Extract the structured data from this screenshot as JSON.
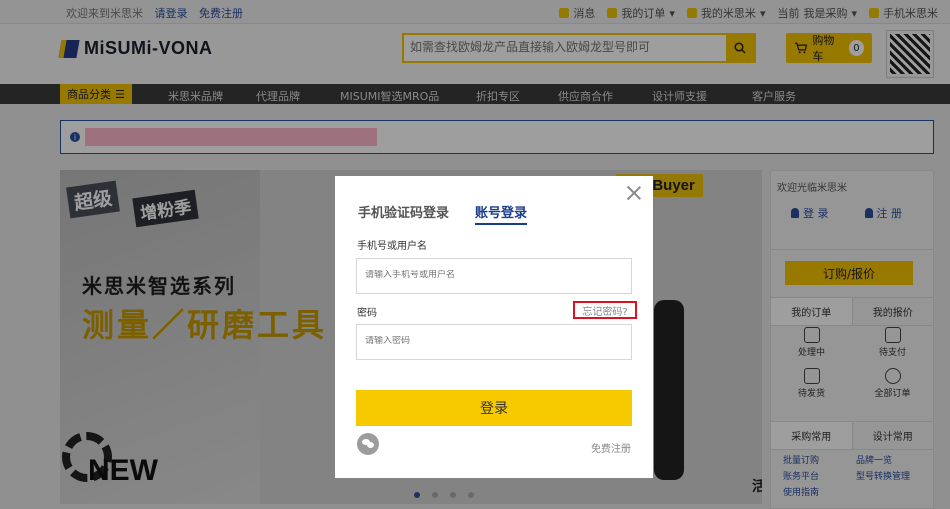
{
  "topbar": {
    "welcome": "欢迎来到米思米",
    "login": "请登录",
    "register": "免费注册",
    "messages": "消息",
    "my_orders": "我的订单",
    "my_misumi": "我的米思米",
    "current_label": "当前",
    "procurement": "我是采购",
    "mobile": "手机米思米"
  },
  "header": {
    "logo_text": "MiSUMi-VONA",
    "search_placeholder": "如需查找欧姆龙产品直接输入欧姆龙型号即可",
    "cart_label": "购物车",
    "cart_count": "0"
  },
  "nav": {
    "category_label": "商品分类",
    "items": [
      "米思米品牌",
      "代理品牌",
      "MISUMI智选MRO品",
      "折扣专区",
      "供应商合作",
      "设计师支援",
      "客户服务"
    ]
  },
  "banner": {
    "tag1": "超级",
    "tag2": "增粉季",
    "title1": "米思米智选系列",
    "title2": "测量／研磨工具",
    "new_text": "NEW",
    "for_buyer": "For Buyer",
    "side_glyph": "活"
  },
  "right_panel": {
    "welcome": "欢迎光临米思米",
    "login": "登 录",
    "register": "注 册",
    "order_quote_btn": "订购/报价",
    "tabs": [
      "我的订单",
      "我的报价"
    ],
    "order_states": [
      "处理中",
      "待支付",
      "待发货",
      "全部订单"
    ],
    "tabs2": [
      "采购常用",
      "设计常用"
    ],
    "links": [
      "批量订购",
      "品牌一览",
      "账务平台",
      "型号转换管理",
      "使用指南"
    ]
  },
  "login_modal": {
    "tab_sms": "手机验证码登录",
    "tab_account": "账号登录",
    "username_label": "手机号或用户名",
    "username_placeholder": "请输入手机号或用户名",
    "password_label": "密码",
    "forgot_password": "忘记密码?",
    "password_placeholder": "请输入密码",
    "submit_label": "登录",
    "register_link": "免费注册"
  },
  "colors": {
    "accent_yellow": "#f5c400",
    "brand_blue": "#1c3c8c",
    "highlight_red": "#e01020"
  }
}
